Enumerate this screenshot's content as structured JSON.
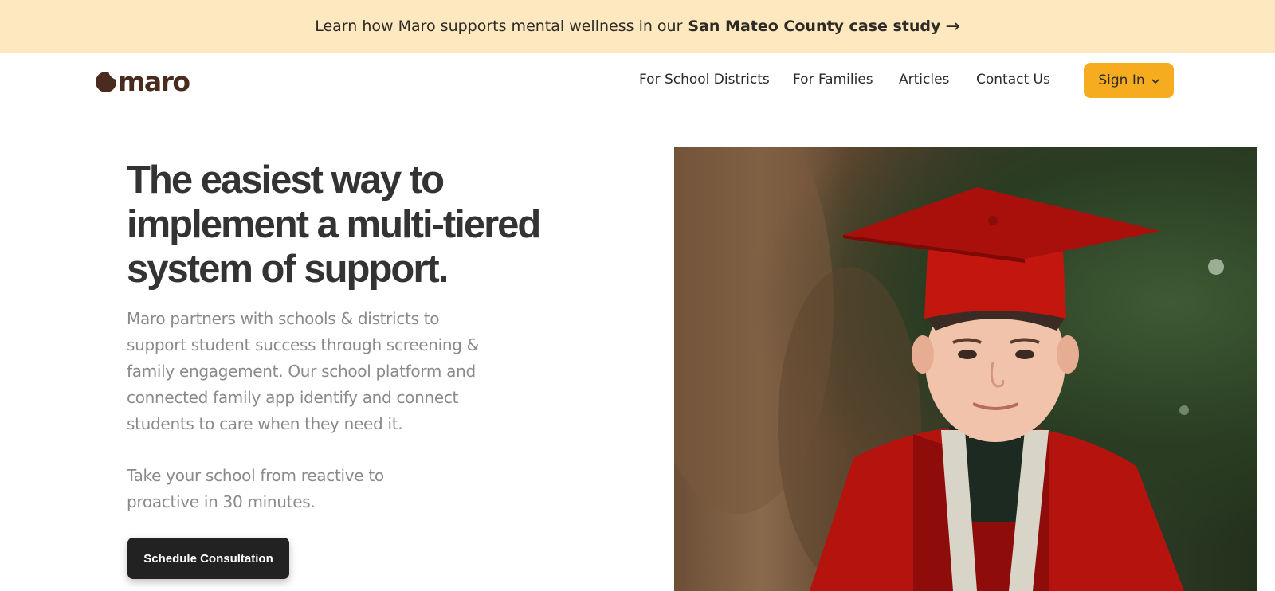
{
  "banner": {
    "text_prefix": "Learn how Maro supports mental wellness in our",
    "link_bold": "San Mateo County case study",
    "arrow": "→"
  },
  "nav": {
    "logo_text": "maro",
    "links": [
      {
        "label": "For School Districts"
      },
      {
        "label": "For Families"
      },
      {
        "label": "Articles"
      },
      {
        "label": "Contact Us"
      }
    ],
    "signin_label": "Sign In",
    "signin_icon": "chevron-down-icon"
  },
  "hero": {
    "headline": "The easiest way to implement a multi-tiered system of support.",
    "paragraph1": "Maro partners with schools & districts to support student success through screening & family engagement. Our school platform and connected family app identify and connect students to care when they need it.",
    "paragraph2": "Take your school from reactive to proactive in 30 minutes.",
    "cta_label": "Schedule Consultation"
  },
  "colors": {
    "banner_bg": "#fde8bf",
    "brand_brown": "#4a2c1f",
    "signin_bg": "#f7ac1f",
    "cta_bg": "#222222"
  }
}
